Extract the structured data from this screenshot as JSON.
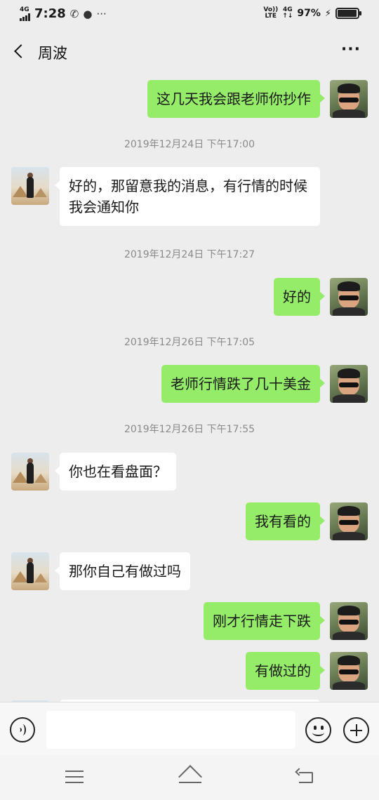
{
  "status_bar": {
    "network_left": "4G",
    "time": "7:28",
    "volte": "Vo))",
    "lte": "LTE",
    "network_right": "4G",
    "battery": "97%"
  },
  "header": {
    "title": "周波",
    "more": "···"
  },
  "messages": [
    {
      "from": "me",
      "text": "这几天我会跟老师你抄作"
    },
    {
      "timestamp": "2019年12月24日 下午17:00"
    },
    {
      "from": "other",
      "text": "好的，那留意我的消息，有行情的时候我会通知你"
    },
    {
      "timestamp": "2019年12月24日 下午17:27"
    },
    {
      "from": "me",
      "text": "好的"
    },
    {
      "timestamp": "2019年12月26日 下午17:05"
    },
    {
      "from": "me",
      "text": "老师行情跌了几十美金"
    },
    {
      "timestamp": "2019年12月26日 下午17:55"
    },
    {
      "from": "other",
      "text": "你也在看盘面？"
    },
    {
      "from": "me",
      "text": "我有看的"
    },
    {
      "from": "other",
      "text": "那你自己有做过吗"
    },
    {
      "from": "me",
      "text": "刚才行情走下跌"
    },
    {
      "from": "me",
      "text": "有做过的"
    }
  ],
  "input": {
    "value": "",
    "placeholder": ""
  },
  "colors": {
    "background": "#ededed",
    "my_bubble": "#95ec69",
    "other_bubble": "#ffffff",
    "timestamp": "#8a8a8a"
  }
}
